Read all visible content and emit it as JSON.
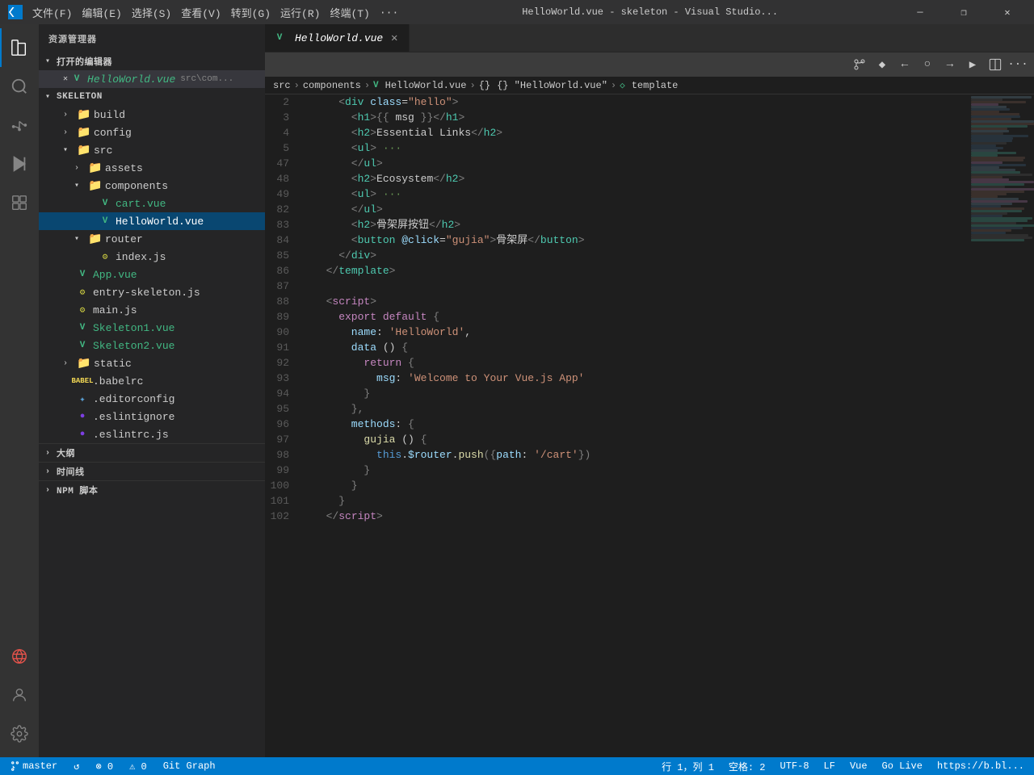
{
  "titlebar": {
    "menu_items": [
      "文件(F)",
      "编辑(E)",
      "选择(S)",
      "查看(V)",
      "转到(G)",
      "运行(R)",
      "终端(T)",
      "···"
    ],
    "title": "HelloWorld.vue - skeleton - Visual Studio...",
    "buttons": [
      "—",
      "❐",
      "✕"
    ]
  },
  "activity_bar": {
    "icons": [
      "explorer",
      "search",
      "source-control",
      "run",
      "extensions",
      "remote-explorer",
      "account",
      "settings"
    ]
  },
  "sidebar": {
    "title": "资源管理器",
    "open_editors_section": "打开的编辑器",
    "open_editors": [
      {
        "name": "HelloWorld.vue",
        "path": "src\\com..."
      }
    ],
    "project_name": "SKELETON",
    "tree": [
      {
        "label": "build",
        "type": "folder",
        "indent": 2,
        "expanded": false
      },
      {
        "label": "config",
        "type": "folder",
        "indent": 2,
        "expanded": false
      },
      {
        "label": "src",
        "type": "folder",
        "indent": 2,
        "expanded": true
      },
      {
        "label": "assets",
        "type": "folder",
        "indent": 3,
        "expanded": false
      },
      {
        "label": "components",
        "type": "folder",
        "indent": 3,
        "expanded": true
      },
      {
        "label": "cart.vue",
        "type": "vue",
        "indent": 4
      },
      {
        "label": "HelloWorld.vue",
        "type": "vue",
        "indent": 4,
        "active": true
      },
      {
        "label": "router",
        "type": "folder",
        "indent": 3,
        "expanded": true
      },
      {
        "label": "index.js",
        "type": "js-gear",
        "indent": 4
      },
      {
        "label": "App.vue",
        "type": "vue",
        "indent": 2
      },
      {
        "label": "entry-skeleton.js",
        "type": "js-gear",
        "indent": 2
      },
      {
        "label": "main.js",
        "type": "js-gear",
        "indent": 2
      },
      {
        "label": "Skeleton1.vue",
        "type": "vue",
        "indent": 2
      },
      {
        "label": "Skeleton2.vue",
        "type": "vue",
        "indent": 2
      },
      {
        "label": "static",
        "type": "folder",
        "indent": 2,
        "expanded": false
      },
      {
        "label": ".babelrc",
        "type": "babel",
        "indent": 2
      },
      {
        "label": ".editorconfig",
        "type": "editorconfig",
        "indent": 2
      },
      {
        "label": ".eslintignore",
        "type": "eslint",
        "indent": 2
      },
      {
        "label": ".eslintrc.js",
        "type": "eslint",
        "indent": 2
      }
    ],
    "outline_section": "大纲",
    "timeline_section": "时间线",
    "npm_section": "NPM 脚本"
  },
  "tab": {
    "filename": "HelloWorld.vue",
    "active": true
  },
  "breadcrumb": {
    "items": [
      "src",
      "components",
      "HelloWorld.vue",
      "{} \"HelloWorld.vue\"",
      "template"
    ]
  },
  "editor": {
    "toolbar_buttons": [
      "⌥",
      "◆",
      "⟵",
      "○",
      "⟶",
      "▶",
      "⊟",
      "···"
    ]
  },
  "code": {
    "lines": [
      {
        "num": "2",
        "content": [
          {
            "cls": "c-bracket",
            "t": "    <"
          },
          {
            "cls": "c-tag",
            "t": "div"
          },
          {
            "cls": "c-attr",
            "t": " class"
          },
          {
            "cls": "c-punct",
            "t": "="
          },
          {
            "cls": "c-val",
            "t": "\"hello\""
          },
          {
            "cls": "c-bracket",
            "t": ">"
          }
        ]
      },
      {
        "num": "3",
        "content": [
          {
            "cls": "c-bracket",
            "t": "      <"
          },
          {
            "cls": "c-tag",
            "t": "h1"
          },
          {
            "cls": "c-bracket",
            "t": ">"
          },
          {
            "cls": "c-bracket",
            "t": "{{"
          },
          {
            "cls": "c-text",
            "t": " msg "
          },
          {
            "cls": "c-bracket",
            "t": "}}"
          },
          {
            "cls": "c-bracket",
            "t": "</"
          },
          {
            "cls": "c-tag",
            "t": "h1"
          },
          {
            "cls": "c-bracket",
            "t": ">"
          }
        ]
      },
      {
        "num": "4",
        "content": [
          {
            "cls": "c-bracket",
            "t": "      <"
          },
          {
            "cls": "c-tag",
            "t": "h2"
          },
          {
            "cls": "c-bracket",
            "t": ">"
          },
          {
            "cls": "c-text",
            "t": "Essential Links"
          },
          {
            "cls": "c-bracket",
            "t": "</"
          },
          {
            "cls": "c-tag",
            "t": "h2"
          },
          {
            "cls": "c-bracket",
            "t": ">"
          }
        ]
      },
      {
        "num": "5",
        "content": [
          {
            "cls": "c-bracket",
            "t": "      <"
          },
          {
            "cls": "c-tag",
            "t": "ul"
          },
          {
            "cls": "c-bracket",
            "t": ">"
          },
          {
            "cls": "c-comment",
            "t": " ···"
          }
        ]
      },
      {
        "num": "47",
        "content": [
          {
            "cls": "c-bracket",
            "t": "      </"
          },
          {
            "cls": "c-tag",
            "t": "ul"
          },
          {
            "cls": "c-bracket",
            "t": ">"
          }
        ]
      },
      {
        "num": "48",
        "content": [
          {
            "cls": "c-bracket",
            "t": "      <"
          },
          {
            "cls": "c-tag",
            "t": "h2"
          },
          {
            "cls": "c-bracket",
            "t": ">"
          },
          {
            "cls": "c-text",
            "t": "Ecosystem"
          },
          {
            "cls": "c-bracket",
            "t": "</"
          },
          {
            "cls": "c-tag",
            "t": "h2"
          },
          {
            "cls": "c-bracket",
            "t": ">"
          }
        ]
      },
      {
        "num": "49",
        "content": [
          {
            "cls": "c-bracket",
            "t": "      <"
          },
          {
            "cls": "c-tag",
            "t": "ul"
          },
          {
            "cls": "c-bracket",
            "t": ">"
          },
          {
            "cls": "c-comment",
            "t": " ···"
          }
        ]
      },
      {
        "num": "82",
        "content": [
          {
            "cls": "c-bracket",
            "t": "      </"
          },
          {
            "cls": "c-tag",
            "t": "ul"
          },
          {
            "cls": "c-bracket",
            "t": ">"
          }
        ]
      },
      {
        "num": "83",
        "content": [
          {
            "cls": "c-bracket",
            "t": "      <"
          },
          {
            "cls": "c-tag",
            "t": "h2"
          },
          {
            "cls": "c-bracket",
            "t": ">"
          },
          {
            "cls": "c-text",
            "t": "骨架屏按钮"
          },
          {
            "cls": "c-bracket",
            "t": "</"
          },
          {
            "cls": "c-tag",
            "t": "h2"
          },
          {
            "cls": "c-bracket",
            "t": ">"
          }
        ]
      },
      {
        "num": "84",
        "content": [
          {
            "cls": "c-bracket",
            "t": "      <"
          },
          {
            "cls": "c-tag",
            "t": "button"
          },
          {
            "cls": "c-attr",
            "t": " @click"
          },
          {
            "cls": "c-punct",
            "t": "="
          },
          {
            "cls": "c-val",
            "t": "\"gujia\""
          },
          {
            "cls": "c-bracket",
            "t": ">"
          },
          {
            "cls": "c-text",
            "t": "骨架屏"
          },
          {
            "cls": "c-bracket",
            "t": "</"
          },
          {
            "cls": "c-tag",
            "t": "button"
          },
          {
            "cls": "c-bracket",
            "t": ">"
          }
        ]
      },
      {
        "num": "85",
        "content": [
          {
            "cls": "c-bracket",
            "t": "    </"
          },
          {
            "cls": "c-tag",
            "t": "div"
          },
          {
            "cls": "c-bracket",
            "t": ">"
          }
        ]
      },
      {
        "num": "86",
        "content": [
          {
            "cls": "c-bracket",
            "t": "  </"
          },
          {
            "cls": "c-tag",
            "t": "template"
          },
          {
            "cls": "c-bracket",
            "t": ">"
          }
        ]
      },
      {
        "num": "87",
        "content": []
      },
      {
        "num": "88",
        "content": [
          {
            "cls": "c-bracket",
            "t": "  <"
          },
          {
            "cls": "c-pink",
            "t": "script"
          },
          {
            "cls": "c-bracket",
            "t": ">"
          }
        ]
      },
      {
        "num": "89",
        "content": [
          {
            "cls": "c-keyword",
            "t": "    export"
          },
          {
            "cls": "c-keyword",
            "t": " default"
          },
          {
            "cls": "c-bracket",
            "t": " {"
          }
        ]
      },
      {
        "num": "90",
        "content": [
          {
            "cls": "c-prop",
            "t": "      name"
          },
          {
            "cls": "c-punct",
            "t": ": "
          },
          {
            "cls": "c-string",
            "t": "'HelloWorld'"
          },
          {
            "cls": "c-punct",
            "t": ","
          }
        ]
      },
      {
        "num": "91",
        "content": [
          {
            "cls": "c-prop",
            "t": "      data"
          },
          {
            "cls": "c-punct",
            "t": " () "
          },
          {
            "cls": "c-bracket",
            "t": "{"
          }
        ]
      },
      {
        "num": "92",
        "content": [
          {
            "cls": "c-keyword",
            "t": "        return"
          },
          {
            "cls": "c-bracket",
            "t": " {"
          }
        ]
      },
      {
        "num": "93",
        "content": [
          {
            "cls": "c-prop",
            "t": "          msg"
          },
          {
            "cls": "c-punct",
            "t": ": "
          },
          {
            "cls": "c-string",
            "t": "'Welcome to Your Vue.js App'"
          }
        ]
      },
      {
        "num": "94",
        "content": [
          {
            "cls": "c-bracket",
            "t": "        }"
          }
        ]
      },
      {
        "num": "95",
        "content": [
          {
            "cls": "c-bracket",
            "t": "      },"
          }
        ]
      },
      {
        "num": "96",
        "content": [
          {
            "cls": "c-prop",
            "t": "      methods"
          },
          {
            "cls": "c-punct",
            "t": ": "
          },
          {
            "cls": "c-bracket",
            "t": "{"
          }
        ]
      },
      {
        "num": "97",
        "content": [
          {
            "cls": "c-func",
            "t": "        gujia"
          },
          {
            "cls": "c-punct",
            "t": " () "
          },
          {
            "cls": "c-bracket",
            "t": "{"
          }
        ]
      },
      {
        "num": "98",
        "content": [
          {
            "cls": "c-blue",
            "t": "          this"
          },
          {
            "cls": "c-punct",
            "t": "."
          },
          {
            "cls": "c-prop",
            "t": "$router"
          },
          {
            "cls": "c-punct",
            "t": "."
          },
          {
            "cls": "c-func",
            "t": "push"
          },
          {
            "cls": "c-bracket",
            "t": "({"
          },
          {
            "cls": "c-prop",
            "t": "path"
          },
          {
            "cls": "c-punct",
            "t": ": "
          },
          {
            "cls": "c-string",
            "t": "'/cart'"
          },
          {
            "cls": "c-bracket",
            "t": "})"
          }
        ]
      },
      {
        "num": "99",
        "content": [
          {
            "cls": "c-bracket",
            "t": "        }"
          }
        ]
      },
      {
        "num": "100",
        "content": [
          {
            "cls": "c-bracket",
            "t": "      }"
          }
        ]
      },
      {
        "num": "101",
        "content": [
          {
            "cls": "c-bracket",
            "t": "    }"
          }
        ]
      },
      {
        "num": "102",
        "content": [
          {
            "cls": "c-bracket",
            "t": "  </"
          },
          {
            "cls": "c-pink",
            "t": "script"
          },
          {
            "cls": "c-bracket",
            "t": ">"
          }
        ]
      }
    ]
  },
  "status_bar": {
    "branch": "master",
    "sync_icon": "↺",
    "errors": "⊗ 0",
    "warnings": "⚠ 0",
    "git_graph": "Git Graph",
    "cursor": "行 1，列 1",
    "spaces": "空格: 2",
    "encoding": "UTF-8",
    "line_ending": "LF",
    "language": "Vue",
    "go_live": "Go Live",
    "url": "https://b.bl..."
  }
}
